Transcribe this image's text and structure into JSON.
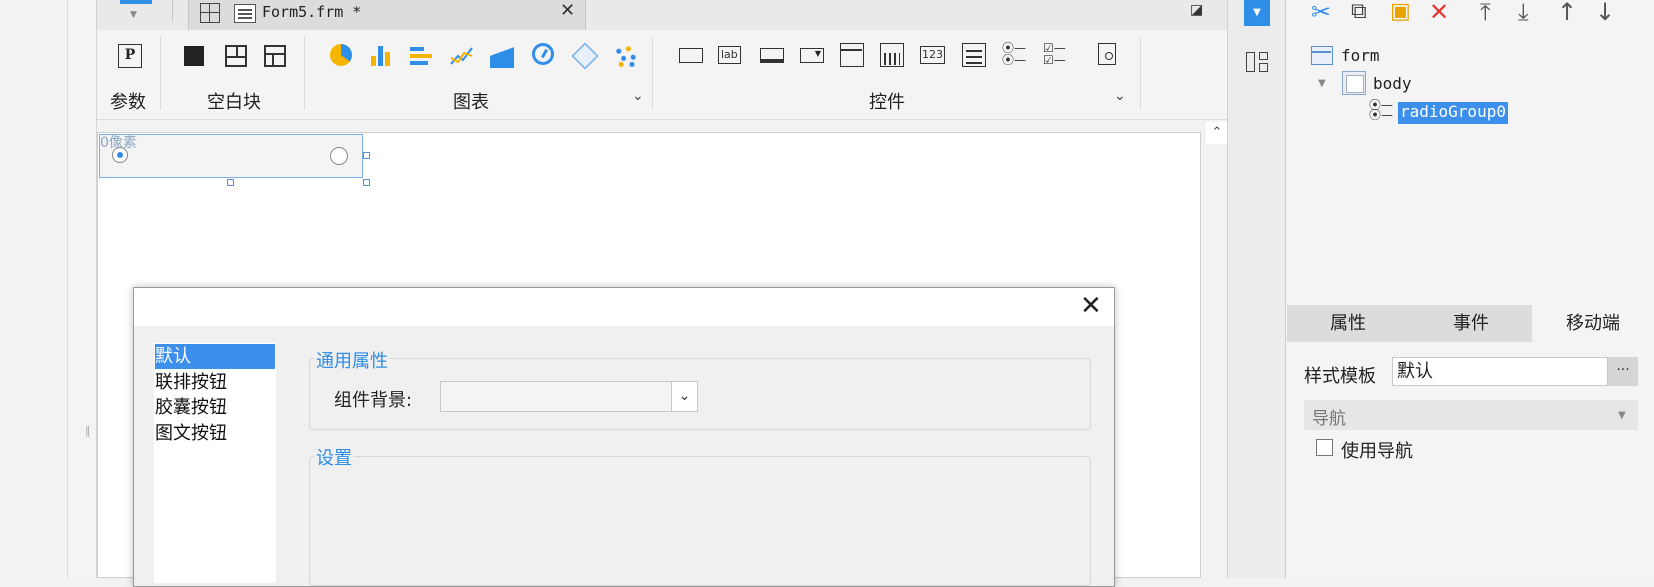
{
  "tab": {
    "title": "Form5.frm *",
    "close": "✕"
  },
  "ribbon": {
    "param_icon": "P",
    "groups": {
      "param": "参数",
      "blank": "空白块",
      "chart": "图表",
      "widget": "控件"
    },
    "chevron": "⌄",
    "label_icon_text": "lab",
    "number_icon_text": "123",
    "chart_icons": [
      "pie-chart-icon",
      "bar-chart-icon",
      "horizontal-bar-icon",
      "line-chart-icon",
      "area-chart-icon",
      "gauge-chart-icon",
      "radar-chart-icon",
      "scatter-chart-icon"
    ],
    "widget_icons": [
      "text-field-icon",
      "label-icon",
      "button-icon",
      "combo-box-icon",
      "tree-combo-icon",
      "date-picker-icon",
      "number-field-icon",
      "text-area-icon",
      "radio-group-icon",
      "checkbox-group-icon",
      "preview-icon"
    ]
  },
  "canvas": {
    "widget_label": "0像素"
  },
  "dialog": {
    "close": "✕",
    "list": [
      "默认",
      "联排按钮",
      "胶囊按钮",
      "图文按钮"
    ],
    "selected_index": 0,
    "section_general": "通用属性",
    "bg_label": "组件背景:",
    "section_settings": "设置"
  },
  "tree": {
    "root": "form",
    "body": "body",
    "child": "radioGroup0"
  },
  "props": {
    "tabs": [
      "属性",
      "事件",
      "移动端"
    ],
    "active_tab": "移动端",
    "style_label": "样式模板",
    "style_value": "默认",
    "dots": "···",
    "nav_section": "导航",
    "use_nav": "使用导航"
  },
  "colors": {
    "accent": "#2e8ee8",
    "selection": "#3c8fea",
    "delete": "#e53935"
  }
}
